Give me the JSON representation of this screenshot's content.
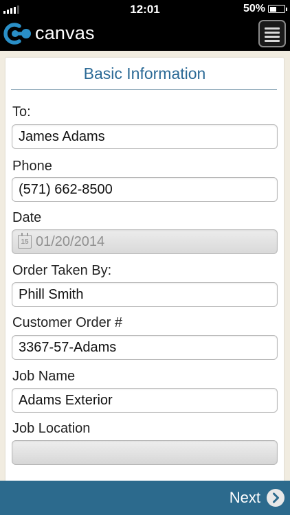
{
  "status_bar": {
    "time": "12:01",
    "battery_percent": "50%",
    "battery_level": 0.5
  },
  "header": {
    "brand": "canvas",
    "menu_icon": "hamburger-menu-icon"
  },
  "form": {
    "title": "Basic Information",
    "fields": {
      "to": {
        "label": "To:",
        "value": "James Adams"
      },
      "phone": {
        "label": "Phone",
        "value": "(571) 662-8500"
      },
      "date": {
        "label": "Date",
        "value": "01/20/2014",
        "icon": "calendar-icon",
        "icon_day": "15"
      },
      "order_taken_by": {
        "label": "Order Taken By:",
        "value": "Phill Smith"
      },
      "customer_order": {
        "label": "Customer Order #",
        "value": "3367-57-Adams"
      },
      "job_name": {
        "label": "Job Name",
        "value": "Adams Exterior"
      },
      "job_location": {
        "label": "Job Location",
        "value": ""
      }
    }
  },
  "footer": {
    "next_label": "Next",
    "next_icon": "chevron-right-circle-icon"
  },
  "colors": {
    "accent": "#2c6a8d",
    "title": "#2b6a96",
    "background": "#f1ece0",
    "logo": "#2a8fc7"
  }
}
